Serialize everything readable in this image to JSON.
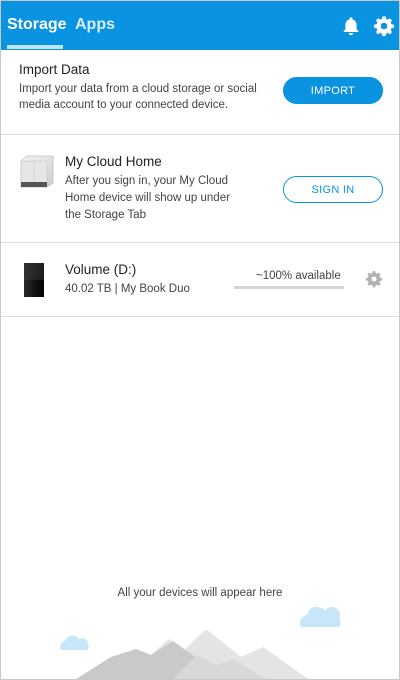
{
  "header": {
    "tabs": [
      {
        "label": "Storage",
        "active": true
      },
      {
        "label": "Apps",
        "active": false
      }
    ],
    "icons": [
      "bell-icon",
      "gear-icon"
    ],
    "accent_color": "#0a93e0"
  },
  "import": {
    "title": "Import Data",
    "description_line1": "Import your data from a cloud storage or social",
    "description_line2": "media account to your connected device.",
    "button_label": "IMPORT"
  },
  "cloud_home": {
    "title": "My Cloud Home",
    "description_line1": "After you sign in, your My Cloud",
    "description_line2": "Home device will show up under",
    "description_line3": "the Storage Tab",
    "button_label": "SIGN IN"
  },
  "volume": {
    "title": "Volume (D:)",
    "subtitle": "40.02 TB | My Book Duo",
    "available_text": "~100% available",
    "available_fraction": 1.0
  },
  "empty_state": {
    "text": "All your devices will appear here"
  }
}
